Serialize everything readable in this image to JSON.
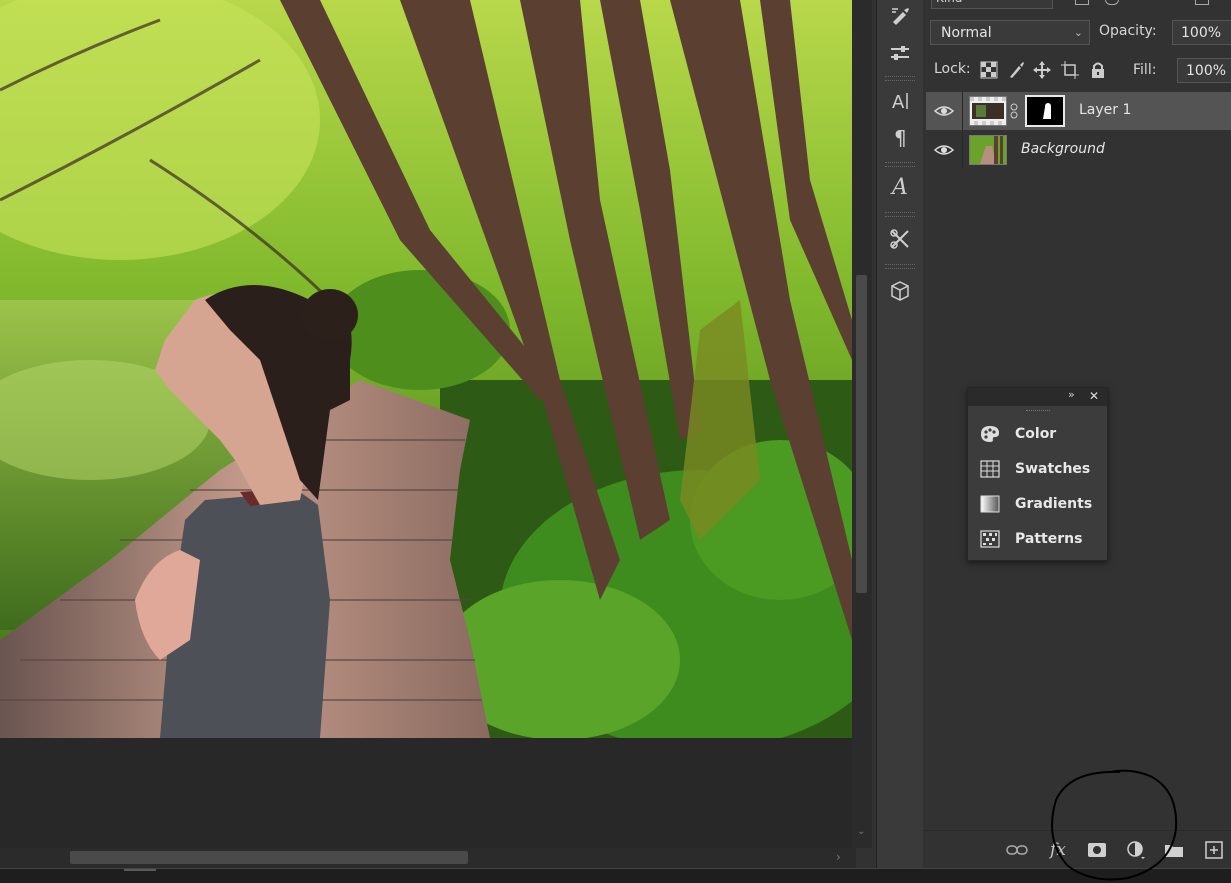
{
  "layers_panel": {
    "kind_filter": "Kind",
    "blend_mode": "Normal",
    "opacity_label": "Opacity:",
    "opacity_value": "100%",
    "lock_label": "Lock:",
    "fill_label": "Fill:",
    "fill_value": "100%",
    "layers": [
      {
        "name": "Layer 1",
        "visible": true,
        "selected": true,
        "has_mask": true
      },
      {
        "name": "Background",
        "visible": true,
        "selected": false,
        "has_mask": false
      }
    ],
    "footer_icons": [
      "link-icon",
      "fx-icon",
      "add-mask-icon",
      "adjustment-layer-icon",
      "group-folder-icon",
      "new-layer-icon"
    ]
  },
  "floating_panel": {
    "items": [
      {
        "label": "Color",
        "icon": "palette-icon"
      },
      {
        "label": "Swatches",
        "icon": "grid-swatches-icon"
      },
      {
        "label": "Gradients",
        "icon": "gradient-icon"
      },
      {
        "label": "Patterns",
        "icon": "patterns-icon"
      }
    ]
  },
  "tools": [
    "brush-icon",
    "sliders-icon",
    "character-icon",
    "paragraph-icon",
    "glyphs-icon",
    "tool-presets-icon",
    "3d-cube-icon"
  ],
  "colors": {
    "panel": "#323232",
    "selected_layer": "#545454",
    "canvas_bg": "#282828"
  }
}
